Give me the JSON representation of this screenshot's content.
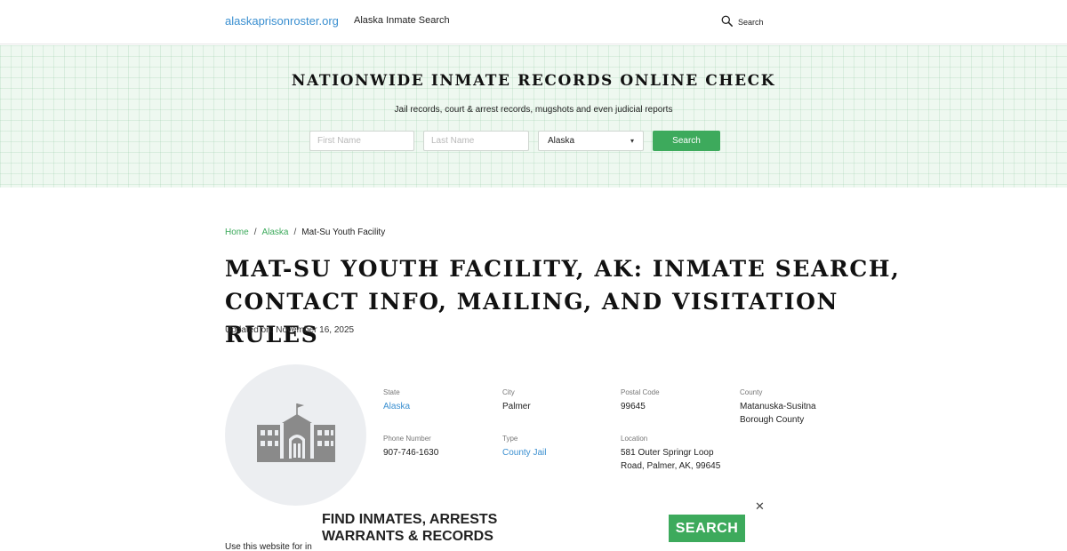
{
  "header": {
    "brand": "alaskaprisonroster.org",
    "nav_link": "Alaska Inmate Search",
    "search_label": "Search"
  },
  "hero": {
    "title": "NATIONWIDE INMATE RECORDS ONLINE CHECK",
    "subtitle": "Jail records, court & arrest records, mugshots and even judicial reports",
    "first_name_placeholder": "First Name",
    "last_name_placeholder": "Last Name",
    "state_selected": "Alaska",
    "search_button": "Search"
  },
  "breadcrumb": {
    "home": "Home",
    "sep1": "/",
    "state": "Alaska",
    "sep2": "/",
    "current": "Mat-Su Youth Facility"
  },
  "page": {
    "title": "MAT-SU YOUTH FACILITY, AK: INMATE SEARCH, CONTACT INFO, MAILING, AND VISITATION RULES",
    "updated": "Updated on: November 16, 2025"
  },
  "facility": {
    "image_icon": "building-icon",
    "state_label": "State",
    "state": "Alaska",
    "city_label": "City",
    "city": "Palmer",
    "postal_label": "Postal Code",
    "postal": "99645",
    "county_label": "County",
    "county": "Matanuska-Susitna Borough County",
    "phone_label": "Phone Number",
    "phone": "907-746-1630",
    "type_label": "Type",
    "type": "County Jail",
    "location_label": "Location",
    "location": "581 Outer Springr Loop Road, Palmer, AK, 99645"
  },
  "ad": {
    "title_line1": "FIND INMATES, ARRESTS",
    "title_line2": "WARRANTS & RECORDS",
    "button": "SEARCH",
    "close": "✕"
  },
  "footer_text": "Use this website for in",
  "colors": {
    "accent_green": "#3daa5c",
    "link_blue": "#3a8fd0",
    "hero_bg": "#eef8f0"
  }
}
